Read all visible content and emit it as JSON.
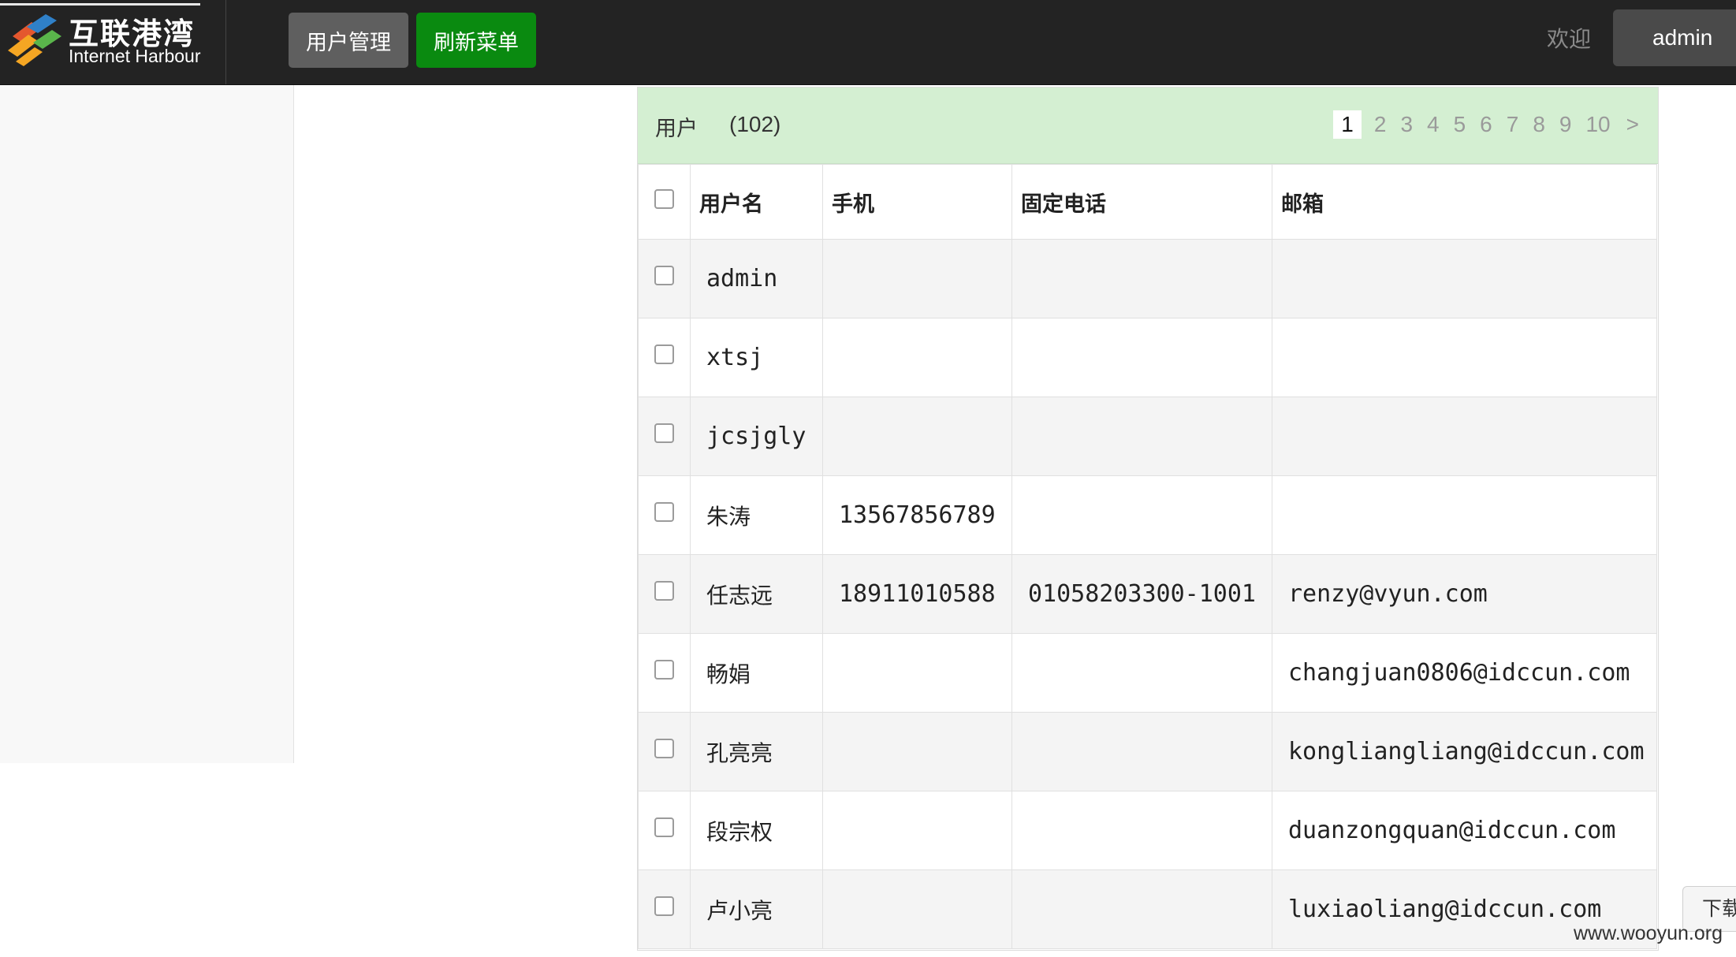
{
  "brand": {
    "name_cn": "互联港湾",
    "name_en": "Internet Harbour",
    "logo_colors": [
      "#e4572e",
      "#f5a623",
      "#2f80c8",
      "#5ab54b"
    ]
  },
  "nav": {
    "user_manage": "用户管理",
    "refresh_menu": "刷新菜单",
    "welcome": "欢迎",
    "user": "admin"
  },
  "panel": {
    "title": "用户",
    "count": "(102)",
    "pages": [
      "1",
      "2",
      "3",
      "4",
      "5",
      "6",
      "7",
      "8",
      "9",
      "10"
    ],
    "current_page": "1",
    "next": ">"
  },
  "table": {
    "headers": [
      "用户名",
      "手机",
      "固定电话",
      "邮箱"
    ],
    "rows": [
      {
        "username": "admin",
        "mobile": "",
        "phone": "",
        "email": ""
      },
      {
        "username": "xtsj",
        "mobile": "",
        "phone": "",
        "email": ""
      },
      {
        "username": "jcsjgly",
        "mobile": "",
        "phone": "",
        "email": ""
      },
      {
        "username": "朱涛",
        "mobile": "13567856789",
        "phone": "",
        "email": ""
      },
      {
        "username": "任志远",
        "mobile": "18911010588",
        "phone": "01058203300-1001",
        "email": "renzy@vyun.com"
      },
      {
        "username": "畅娟",
        "mobile": "",
        "phone": "",
        "email": "changjuan0806@idccun.com"
      },
      {
        "username": "孔亮亮",
        "mobile": "",
        "phone": "",
        "email": "kongliangliang@idccun.com"
      },
      {
        "username": "段宗权",
        "mobile": "",
        "phone": "",
        "email": "duanzongquan@idccun.com"
      },
      {
        "username": "卢小亮",
        "mobile": "",
        "phone": "",
        "email": "luxiaoliang@idccun.com"
      }
    ]
  },
  "download_tab": "下载",
  "watermark": "www.wooyun.org"
}
